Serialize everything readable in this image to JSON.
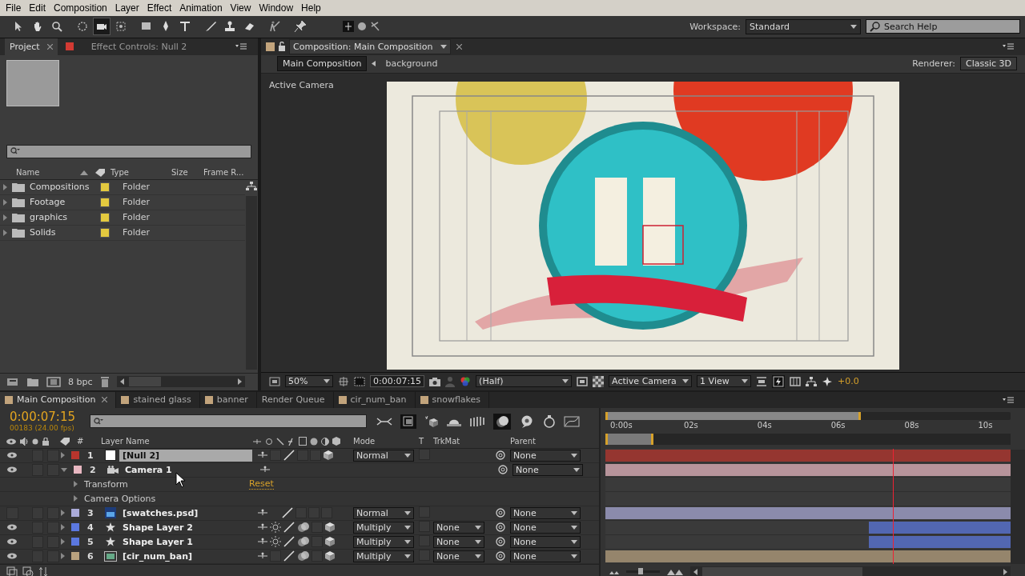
{
  "menu": [
    "File",
    "Edit",
    "Composition",
    "Layer",
    "Effect",
    "Animation",
    "View",
    "Window",
    "Help"
  ],
  "tools": [
    {
      "kind": "select",
      "selected": false
    },
    {
      "kind": "hand",
      "selected": false
    },
    {
      "kind": "zoom",
      "selected": false
    },
    {
      "kind": "rotate",
      "selected": false
    },
    {
      "kind": "camera",
      "selected": true
    },
    {
      "kind": "pan",
      "selected": false
    },
    {
      "kind": "rect",
      "selected": false
    },
    {
      "kind": "pen",
      "selected": false
    },
    {
      "kind": "text",
      "selected": false
    },
    {
      "kind": "brush",
      "selected": false
    },
    {
      "kind": "stamp",
      "selected": false
    },
    {
      "kind": "eraser",
      "selected": false
    },
    {
      "kind": "roto",
      "selected": false
    },
    {
      "kind": "pin",
      "selected": false
    }
  ],
  "workspace": {
    "label": "Workspace:",
    "value": "Standard"
  },
  "search_help": {
    "placeholder": "Search Help"
  },
  "project_panel": {
    "tabs": [
      {
        "label": "Project",
        "selected": true
      },
      {
        "label": "Effect Controls: Null 2",
        "selected": false
      }
    ],
    "columns": [
      "Name",
      "Type",
      "Size",
      "Frame R..."
    ],
    "items": [
      {
        "name": "Compositions",
        "color": "#e3c93f",
        "type": "Folder"
      },
      {
        "name": "Footage",
        "color": "#e3c93f",
        "type": "Folder"
      },
      {
        "name": "graphics",
        "color": "#e3c93f",
        "type": "Folder"
      },
      {
        "name": "Solids",
        "color": "#e3c93f",
        "type": "Folder"
      }
    ],
    "bit_depth": "8 bpc"
  },
  "composition_panel": {
    "tab": "Composition: Main Composition",
    "breadcrumbs": [
      {
        "label": "Main Composition",
        "selected": true
      },
      {
        "label": "background",
        "selected": false
      }
    ],
    "renderer_label": "Renderer:",
    "renderer": "Classic 3D",
    "view_label": "Active Camera",
    "zoom": "50%",
    "timecode": "0:00:07:15",
    "resolution": "(Half)",
    "camera": "Active Camera",
    "views": "1 View",
    "exposure": "+0.0"
  },
  "timeline": {
    "tabs": [
      {
        "label": "Main Composition",
        "selected": true,
        "color": "#c2a47c"
      },
      {
        "label": "stained glass",
        "selected": false,
        "color": "#c2a47c"
      },
      {
        "label": "banner",
        "selected": false,
        "color": "#c2a47c"
      },
      {
        "label": "Render Queue",
        "selected": false
      },
      {
        "label": "cir_num_ban",
        "selected": false,
        "color": "#c2a47c"
      },
      {
        "label": "snowflakes",
        "selected": false,
        "color": "#c2a47c"
      }
    ],
    "timecode": "0:00:07:15",
    "frame_info": "00183 (24.00 fps)",
    "columns": {
      "number": "#",
      "name": "Layer Name",
      "mode": "Mode",
      "t": "T",
      "trkmat": "TrkMat",
      "parent": "Parent"
    },
    "ruler": [
      "0:00s",
      "02s",
      "04s",
      "06s",
      "08s",
      "10s"
    ],
    "work_area": {
      "level": 0.63
    },
    "playhead": {
      "level": 0.71
    },
    "zoom_slider": {
      "level": 0.35
    },
    "layers": [
      {
        "number": "1",
        "name": "[Null 2]",
        "color": "#b8352d",
        "kind": "null",
        "visible": true,
        "expanded": false,
        "selected": true,
        "mode": "Normal",
        "parent": "None",
        "bar": {
          "level": 1
        }
      },
      {
        "number": "2",
        "name": "Camera 1",
        "color": "#e8b7c1",
        "kind": "camera",
        "visible": true,
        "expanded": true,
        "selected": false,
        "parent": "None",
        "bar": {
          "level": 1
        },
        "properties": [
          {
            "name": "Transform",
            "value": "Reset"
          },
          {
            "name": "Camera Options"
          }
        ]
      },
      {
        "number": "3",
        "name": "[swatches.psd]",
        "color": "#aaaad8",
        "kind": "psd",
        "visible": false,
        "expanded": false,
        "selected": false,
        "mode": "Normal",
        "parent": "None",
        "bar": {
          "level": 1
        }
      },
      {
        "number": "4",
        "name": "Shape Layer 2",
        "color": "#5b78e0",
        "kind": "shape",
        "visible": true,
        "expanded": false,
        "selected": false,
        "mode": "Multiply",
        "trkmat": "None",
        "parent": "None",
        "bar": {
          "level": 0.35
        }
      },
      {
        "number": "5",
        "name": "Shape Layer 1",
        "color": "#5b78e0",
        "kind": "shape",
        "visible": true,
        "expanded": false,
        "selected": false,
        "mode": "Multiply",
        "trkmat": "None",
        "parent": "None",
        "bar": {
          "level": 0.35
        }
      },
      {
        "number": "6",
        "name": "[cir_num_ban]",
        "color": "#b9a27f",
        "kind": "comp",
        "visible": true,
        "expanded": false,
        "selected": false,
        "mode": "Multiply",
        "trkmat": "None",
        "parent": "None",
        "bar": {
          "level": 1
        }
      }
    ]
  }
}
